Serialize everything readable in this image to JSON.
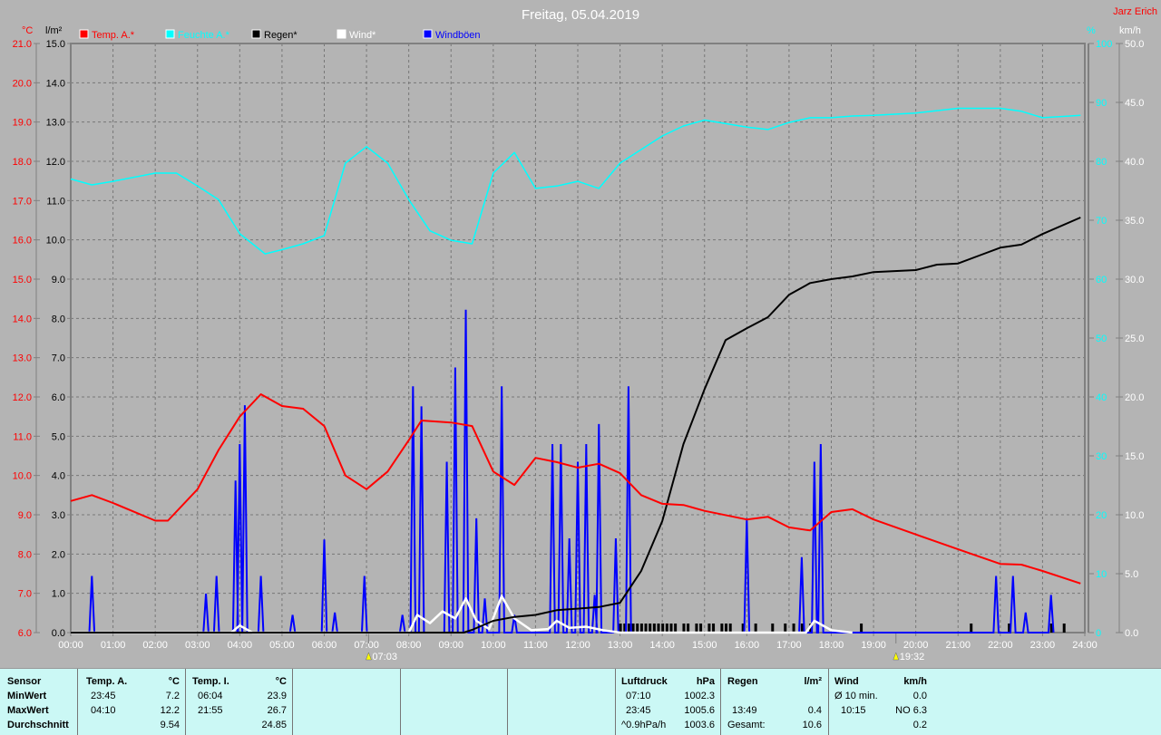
{
  "title": "Freitag, 05.04.2019",
  "author": "Jarz Erich",
  "colors": {
    "temp": "#ff0000",
    "humidity": "#00ffff",
    "rain": "#000000",
    "wind": "#ffffff",
    "gusts": "#0000ff",
    "background": "#b4b4b4",
    "table": "#cbf8f5"
  },
  "chart_data": {
    "type": "line",
    "title": "Freitag, 05.04.2019",
    "legend": [
      {
        "label": "Temp. A.*",
        "color": "#ff0000"
      },
      {
        "label": "Feuchte A.*",
        "color": "#00ffff"
      },
      {
        "label": "Regen*",
        "color": "#000000"
      },
      {
        "label": "Wind*",
        "color": "#ffffff"
      },
      {
        "label": "Windböen",
        "color": "#0000ff"
      }
    ],
    "axes": {
      "temp": {
        "unit": "°C",
        "min": 6,
        "max": 21,
        "ticks": [
          "6.0",
          "7.0",
          "8.0",
          "9.0",
          "10.0",
          "11.0",
          "12.0",
          "13.0",
          "14.0",
          "15.0",
          "16.0",
          "17.0",
          "18.0",
          "19.0",
          "20.0",
          "21.0"
        ]
      },
      "rain": {
        "unit": "l/m²",
        "min": 0,
        "max": 15,
        "ticks": [
          "0.0",
          "1.0",
          "2.0",
          "3.0",
          "4.0",
          "5.0",
          "6.0",
          "7.0",
          "8.0",
          "9.0",
          "10.0",
          "11.0",
          "12.0",
          "13.0",
          "14.0",
          "15.0"
        ]
      },
      "humidity": {
        "unit": "%",
        "min": 0,
        "max": 100,
        "ticks": [
          "0",
          "10",
          "20",
          "30",
          "40",
          "50",
          "60",
          "70",
          "80",
          "90",
          "100"
        ]
      },
      "wind": {
        "unit": "km/h",
        "min": 0,
        "max": 50,
        "ticks": [
          "0.0",
          "5.0",
          "10.0",
          "15.0",
          "20.0",
          "25.0",
          "30.0",
          "35.0",
          "40.0",
          "45.0",
          "50.0"
        ]
      },
      "x": {
        "min": 0,
        "max": 24,
        "ticks": [
          "00:00",
          "01:00",
          "02:00",
          "03:00",
          "04:00",
          "05:00",
          "06:00",
          "07:00",
          "08:00",
          "09:00",
          "10:00",
          "11:00",
          "12:00",
          "13:00",
          "14:00",
          "15:00",
          "16:00",
          "17:00",
          "18:00",
          "19:00",
          "20:00",
          "21:00",
          "22:00",
          "23:00",
          "24:00"
        ]
      }
    },
    "grid": true,
    "sun": {
      "sunrise": "07:03",
      "sunset": "19:32",
      "sunrise_h": 7.05,
      "sunset_h": 19.53
    },
    "series": {
      "temp": [
        [
          0,
          9.35
        ],
        [
          0.5,
          9.5
        ],
        [
          1,
          9.3
        ],
        [
          2,
          8.85
        ],
        [
          2.3,
          8.85
        ],
        [
          3,
          9.65
        ],
        [
          3.5,
          10.65
        ],
        [
          4,
          11.5
        ],
        [
          4.5,
          12.07
        ],
        [
          5,
          11.77
        ],
        [
          5.5,
          11.7
        ],
        [
          6,
          11.26
        ],
        [
          6.5,
          10.0
        ],
        [
          7,
          9.65
        ],
        [
          7.5,
          10.1
        ],
        [
          8,
          10.9
        ],
        [
          8.3,
          11.4
        ],
        [
          9,
          11.35
        ],
        [
          9.5,
          11.26
        ],
        [
          10,
          10.1
        ],
        [
          10.5,
          9.76
        ],
        [
          11,
          10.45
        ],
        [
          11.5,
          10.34
        ],
        [
          12,
          10.2
        ],
        [
          12.5,
          10.3
        ],
        [
          13,
          10.06
        ],
        [
          13.5,
          9.5
        ],
        [
          14,
          9.28
        ],
        [
          14.5,
          9.25
        ],
        [
          15,
          9.1
        ],
        [
          16,
          8.88
        ],
        [
          16.5,
          8.95
        ],
        [
          17,
          8.68
        ],
        [
          17.5,
          8.6
        ],
        [
          18,
          9.07
        ],
        [
          18.5,
          9.14
        ],
        [
          19,
          8.88
        ],
        [
          20,
          8.5
        ],
        [
          21,
          8.12
        ],
        [
          22,
          7.75
        ],
        [
          22.5,
          7.73
        ],
        [
          23,
          7.57
        ],
        [
          23.9,
          7.25
        ]
      ],
      "humidity": [
        [
          0,
          77
        ],
        [
          0.5,
          76
        ],
        [
          1,
          76.6
        ],
        [
          2,
          78
        ],
        [
          2.5,
          78
        ],
        [
          3,
          75.8
        ],
        [
          3.5,
          73.5
        ],
        [
          4,
          67.7
        ],
        [
          4.6,
          64.3
        ],
        [
          5,
          65
        ],
        [
          5.5,
          66
        ],
        [
          6,
          67.4
        ],
        [
          6.5,
          79.7
        ],
        [
          7,
          82.5
        ],
        [
          7.5,
          79.7
        ],
        [
          8,
          73.5
        ],
        [
          8.5,
          68.2
        ],
        [
          9,
          66.6
        ],
        [
          9.5,
          66
        ],
        [
          10,
          78
        ],
        [
          10.5,
          81.5
        ],
        [
          11,
          75.4
        ],
        [
          11.5,
          75.8
        ],
        [
          12,
          76.6
        ],
        [
          12.5,
          75.4
        ],
        [
          13,
          79.7
        ],
        [
          13.5,
          82
        ],
        [
          14,
          84.3
        ],
        [
          14.5,
          86
        ],
        [
          15,
          87
        ],
        [
          16,
          85.8
        ],
        [
          16.5,
          85.4
        ],
        [
          17,
          86.6
        ],
        [
          17.5,
          87.4
        ],
        [
          18,
          87.4
        ],
        [
          18.5,
          87.7
        ],
        [
          19,
          87.8
        ],
        [
          20,
          88.2
        ],
        [
          21,
          89
        ],
        [
          22,
          89
        ],
        [
          22.5,
          88.5
        ],
        [
          23,
          87.4
        ],
        [
          23.9,
          87.8
        ]
      ],
      "rain_total": [
        [
          0,
          0
        ],
        [
          9.3,
          0
        ],
        [
          9.5,
          0.07
        ],
        [
          10,
          0.3
        ],
        [
          10.5,
          0.4
        ],
        [
          11,
          0.45
        ],
        [
          11.5,
          0.57
        ],
        [
          12.5,
          0.65
        ],
        [
          13,
          0.76
        ],
        [
          13.5,
          1.57
        ],
        [
          14,
          2.84
        ],
        [
          14.5,
          4.8
        ],
        [
          15,
          6.2
        ],
        [
          15.5,
          7.45
        ],
        [
          16,
          7.75
        ],
        [
          16.5,
          8.03
        ],
        [
          17,
          8.6
        ],
        [
          17.5,
          8.9
        ],
        [
          18,
          9.0
        ],
        [
          18.5,
          9.07
        ],
        [
          19,
          9.18
        ],
        [
          20,
          9.23
        ],
        [
          20.5,
          9.37
        ],
        [
          21,
          9.4
        ],
        [
          21.5,
          9.6
        ],
        [
          22,
          9.8
        ],
        [
          22.5,
          9.88
        ],
        [
          23,
          10.15
        ],
        [
          23.9,
          10.57
        ]
      ],
      "rain_bars": [
        13.0,
        13.1,
        13.2,
        13.3,
        13.4,
        13.5,
        13.6,
        13.7,
        13.8,
        13.9,
        14.0,
        14.1,
        14.2,
        14.3,
        14.5,
        14.6,
        14.8,
        14.9,
        15.1,
        15.2,
        15.4,
        15.5,
        15.6,
        15.9,
        16.2,
        16.6,
        16.9,
        17.1,
        17.3,
        17.5,
        18.7,
        21.3,
        22.2,
        23.2,
        23.5
      ],
      "wind": [
        [
          0,
          0
        ],
        [
          3.8,
          0
        ],
        [
          4,
          0.6
        ],
        [
          4.3,
          0
        ],
        [
          8,
          0
        ],
        [
          8.2,
          1.5
        ],
        [
          8.5,
          0.8
        ],
        [
          8.8,
          1.8
        ],
        [
          9.1,
          1.2
        ],
        [
          9.35,
          2.9
        ],
        [
          9.6,
          1
        ],
        [
          9.9,
          0.3
        ],
        [
          10.2,
          3.1
        ],
        [
          10.5,
          1.2
        ],
        [
          10.9,
          0.2
        ],
        [
          11.3,
          0.3
        ],
        [
          11.5,
          1
        ],
        [
          11.8,
          0.4
        ],
        [
          12.2,
          0.5
        ],
        [
          12.6,
          0.2
        ],
        [
          13,
          0
        ],
        [
          17.4,
          0
        ],
        [
          17.6,
          1
        ],
        [
          18,
          0.2
        ],
        [
          18.5,
          0
        ]
      ],
      "gusts": [
        [
          0.5,
          4.8
        ],
        [
          3.2,
          3.3
        ],
        [
          3.45,
          4.8
        ],
        [
          3.9,
          12.9
        ],
        [
          4.0,
          16
        ],
        [
          4.12,
          19.3
        ],
        [
          4.5,
          4.8
        ],
        [
          5.25,
          1.5
        ],
        [
          6.0,
          7.9
        ],
        [
          6.25,
          1.7
        ],
        [
          6.95,
          4.8
        ],
        [
          7.85,
          1.5
        ],
        [
          8.1,
          20.9
        ],
        [
          8.3,
          19.2
        ],
        [
          8.9,
          14.5
        ],
        [
          9.1,
          22.5
        ],
        [
          9.35,
          27.4
        ],
        [
          9.6,
          9.7
        ],
        [
          9.8,
          2.9
        ],
        [
          10.2,
          20.9
        ],
        [
          10.5,
          1.5
        ],
        [
          11.4,
          16
        ],
        [
          11.6,
          16
        ],
        [
          11.8,
          8
        ],
        [
          12.0,
          14.5
        ],
        [
          12.2,
          16
        ],
        [
          12.4,
          3.2
        ],
        [
          12.5,
          17.7
        ],
        [
          12.9,
          8
        ],
        [
          13.2,
          20.9
        ],
        [
          16.0,
          9.7
        ],
        [
          17.3,
          6.4
        ],
        [
          17.6,
          14.5
        ],
        [
          17.75,
          16
        ],
        [
          21.9,
          4.8
        ],
        [
          22.3,
          4.8
        ],
        [
          22.6,
          1.7
        ],
        [
          23.2,
          3.2
        ]
      ]
    }
  },
  "table": {
    "sensor": {
      "header": "Sensor",
      "rows": [
        "MinWert",
        "MaxWert",
        "Durchschnitt"
      ]
    },
    "temp_a": {
      "header": "Temp. A.",
      "unit": "°C",
      "min_time": "23:45",
      "min": "7.2",
      "max_time": "04:10",
      "max": "12.2",
      "avg": "9.54"
    },
    "temp_i": {
      "header": "Temp. I.",
      "unit": "°C",
      "min_time": "06:04",
      "min": "23.9",
      "max_time": "21:55",
      "max": "26.7",
      "avg": "24.85"
    },
    "pressure": {
      "header": "Luftdruck",
      "unit": "hPa",
      "min_time": "07:10",
      "min": "1002.3",
      "max_time": "23:45",
      "max": "1005.6",
      "trend": "^0.9hPa/h",
      "avg": "1003.6"
    },
    "rain": {
      "header": "Regen",
      "unit": "l/m²",
      "max_time": "13:49",
      "max": "0.4",
      "total_label": "Gesamt:",
      "total": "10.6"
    },
    "wind": {
      "header": "Wind",
      "unit": "km/h",
      "avg10_label": "Ø 10 min.",
      "avg10": "0.0",
      "max_time": "10:15",
      "max": "NO 6.3",
      "avg": "0.2"
    }
  }
}
